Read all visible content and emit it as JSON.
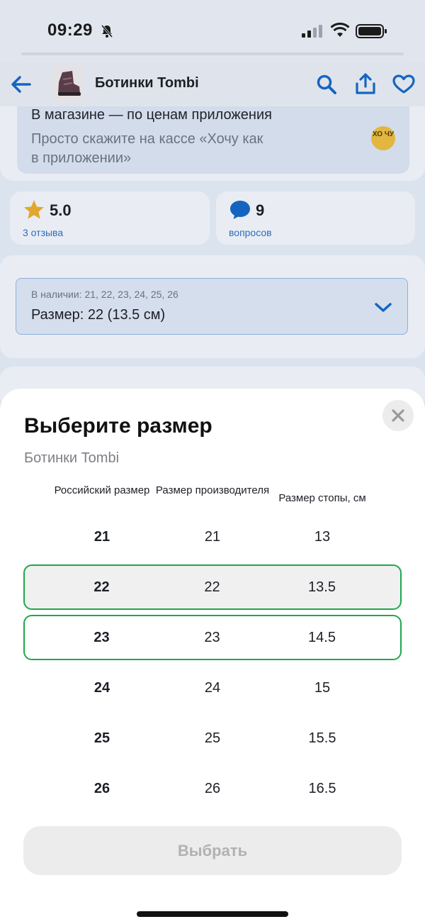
{
  "status_bar": {
    "time": "09:29"
  },
  "header": {
    "title": "Ботинки Tombi"
  },
  "promo": {
    "title": "В магазине — по ценам приложения",
    "text": "Просто скажите на кассе «Хочу как в приложении»",
    "badge": "ХО ЧУ"
  },
  "rating": {
    "value": "5.0",
    "label": "3 отзыва"
  },
  "questions": {
    "value": "9",
    "label": "вопросов"
  },
  "size_selector": {
    "available": "В наличии: 21, 22, 23, 24, 25, 26",
    "value": "Размер: 22 (13.5 см)"
  },
  "sheet": {
    "title": "Выберите размер",
    "subtitle": "Ботинки Tombi",
    "columns": [
      "Российский размер",
      "Размер производителя",
      "Размер стопы, см"
    ],
    "rows": [
      [
        "21",
        "21",
        "13"
      ],
      [
        "22",
        "22",
        "13.5"
      ],
      [
        "23",
        "23",
        "14.5"
      ],
      [
        "24",
        "24",
        "15"
      ],
      [
        "25",
        "25",
        "15.5"
      ],
      [
        "26",
        "26",
        "16.5"
      ]
    ],
    "choose_label": "Выбрать"
  },
  "colors": {
    "accent_blue": "#1565c0",
    "selection_green": "#1fa84c",
    "star": "#e2a72e"
  }
}
